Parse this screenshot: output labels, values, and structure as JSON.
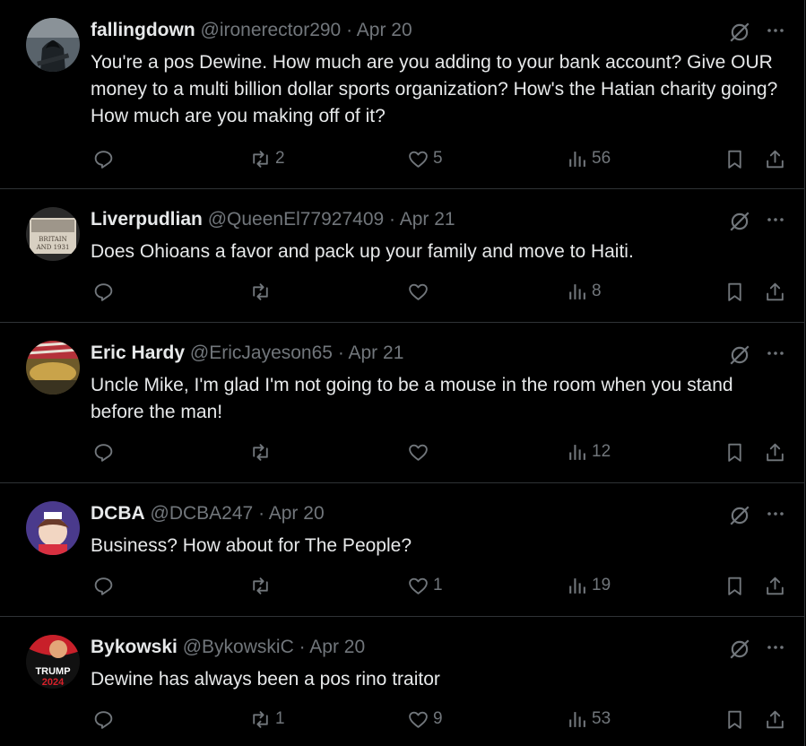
{
  "tweets": [
    {
      "name": "fallingdown",
      "handle": "@ironerector290",
      "date": "Apr 20",
      "text": "You're a pos Dewine. How much are you adding to your bank account? Give OUR money to a multi billion dollar sports organization? How's the Hatian charity going? How much are you making off of it?",
      "reposts": "2",
      "likes": "5",
      "views": "56"
    },
    {
      "name": "Liverpudlian",
      "handle": "@QueenEl77927409",
      "date": "Apr 21",
      "text": "Does Ohioans a favor and pack up your family and move to Haiti.",
      "reposts": "",
      "likes": "",
      "views": "8"
    },
    {
      "name": "Eric Hardy",
      "handle": "@EricJayeson65",
      "date": "Apr 21",
      "text": "Uncle Mike, I'm glad I'm not going to be a mouse in the room when you stand before the man!",
      "reposts": "",
      "likes": "",
      "views": "12"
    },
    {
      "name": "DCBA",
      "handle": "@DCBA247",
      "date": "Apr 20",
      "text": "Business? How about for The People?",
      "reposts": "",
      "likes": "1",
      "views": "19"
    },
    {
      "name": "Bykowski",
      "handle": "@BykowskiC",
      "date": "Apr 20",
      "text": "Dewine has always been a pos rino traitor",
      "reposts": "1",
      "likes": "9",
      "views": "53"
    }
  ],
  "separator": "·",
  "avatar_labels": {
    "tweet2": "BRITAIN AND 1931",
    "tweet5": "TRUMP 2024"
  },
  "icons": [
    "grok-icon",
    "more-icon",
    "reply-icon",
    "repost-icon",
    "like-icon",
    "views-icon",
    "bookmark-icon",
    "share-icon"
  ],
  "colors": {
    "background": "#000000",
    "text": "#e7e9ea",
    "muted": "#71767b",
    "border": "#2f3336"
  }
}
